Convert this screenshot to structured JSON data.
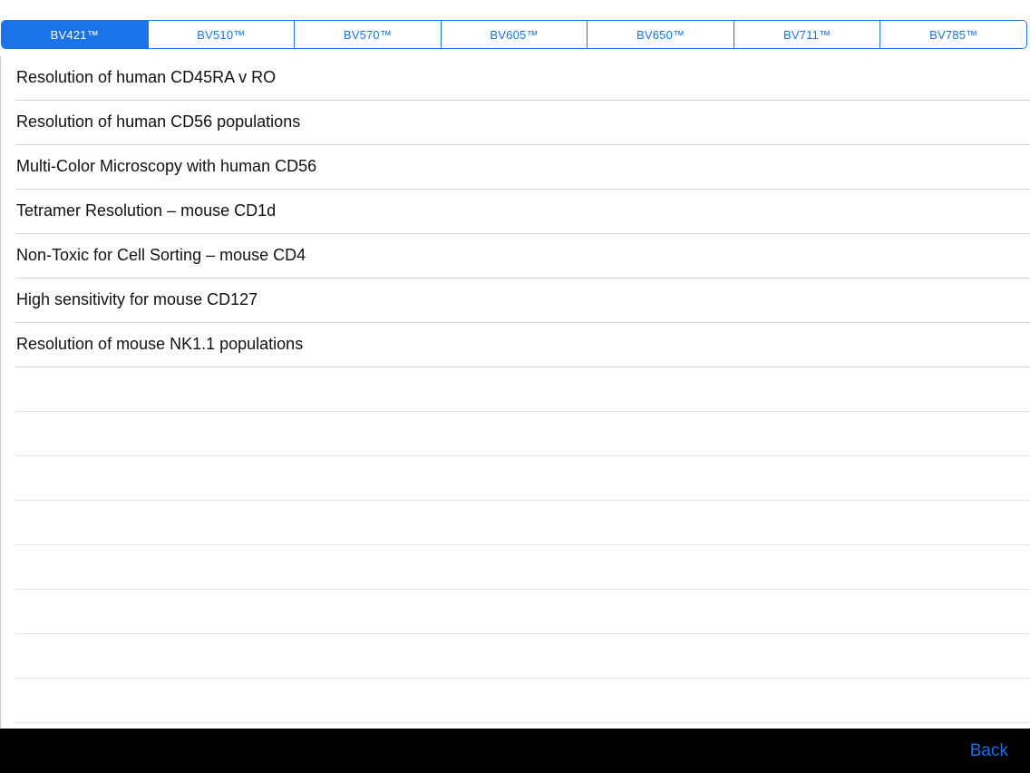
{
  "tabs": [
    {
      "label": "BV421™",
      "selected": true
    },
    {
      "label": "BV510™",
      "selected": false
    },
    {
      "label": "BV570™",
      "selected": false
    },
    {
      "label": "BV605™",
      "selected": false
    },
    {
      "label": "BV650™",
      "selected": false
    },
    {
      "label": "BV711™",
      "selected": false
    },
    {
      "label": "BV785™",
      "selected": false
    }
  ],
  "list": {
    "items": [
      "Resolution of human CD45RA v RO",
      "Resolution of human CD56 populations",
      "Multi-Color Microscopy with human CD56",
      "Tetramer Resolution – mouse CD1d",
      "Non-Toxic for Cell Sorting – mouse CD4",
      "High sensitivity for mouse CD127",
      "Resolution of mouse NK1.1 populations"
    ]
  },
  "toolbar": {
    "back_label": "Back"
  },
  "colors": {
    "accent": "#1a73e8",
    "toolbar_bg": "#000000"
  }
}
